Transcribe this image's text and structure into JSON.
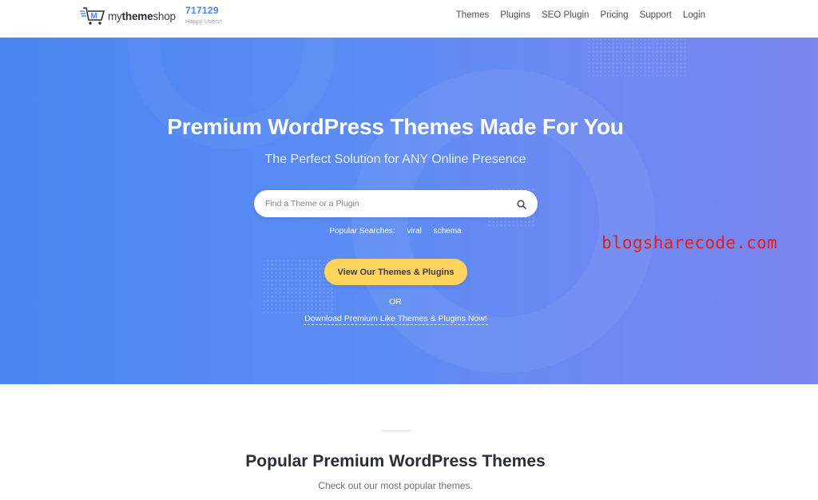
{
  "header": {
    "brand": {
      "prefix": "my",
      "bold": "theme",
      "suffix": "shop"
    },
    "counter": {
      "value": "717129",
      "label": "Happy Users!"
    },
    "nav": [
      "Themes",
      "Plugins",
      "SEO Plugin",
      "Pricing",
      "Support",
      "Login"
    ]
  },
  "hero": {
    "title": "Premium WordPress Themes Made For You",
    "subtitle": "The Perfect Solution for ANY Online Presence",
    "search": {
      "placeholder": "Find a Theme or a Plugin",
      "value": ""
    },
    "popular": {
      "label": "Popular Searches:",
      "terms": [
        "viral",
        "schema"
      ]
    },
    "cta_label": "View Our Themes & Plugins",
    "or_text": "OR",
    "download_link": "Download Premium Like Themes & Plugins Now!",
    "watermark": "blogsharecode.com"
  },
  "section": {
    "title": "Popular Premium WordPress Themes",
    "subtitle": "Check out our most popular themes."
  },
  "colors": {
    "brand_blue": "#4a86e8",
    "cta_yellow": "#fcd35c",
    "hero_gradient_start": "#4b86f0",
    "hero_gradient_end": "#7b86f0",
    "watermark_red": "#e11d1d"
  },
  "icons": [
    "cart-logo-icon",
    "search-icon"
  ]
}
